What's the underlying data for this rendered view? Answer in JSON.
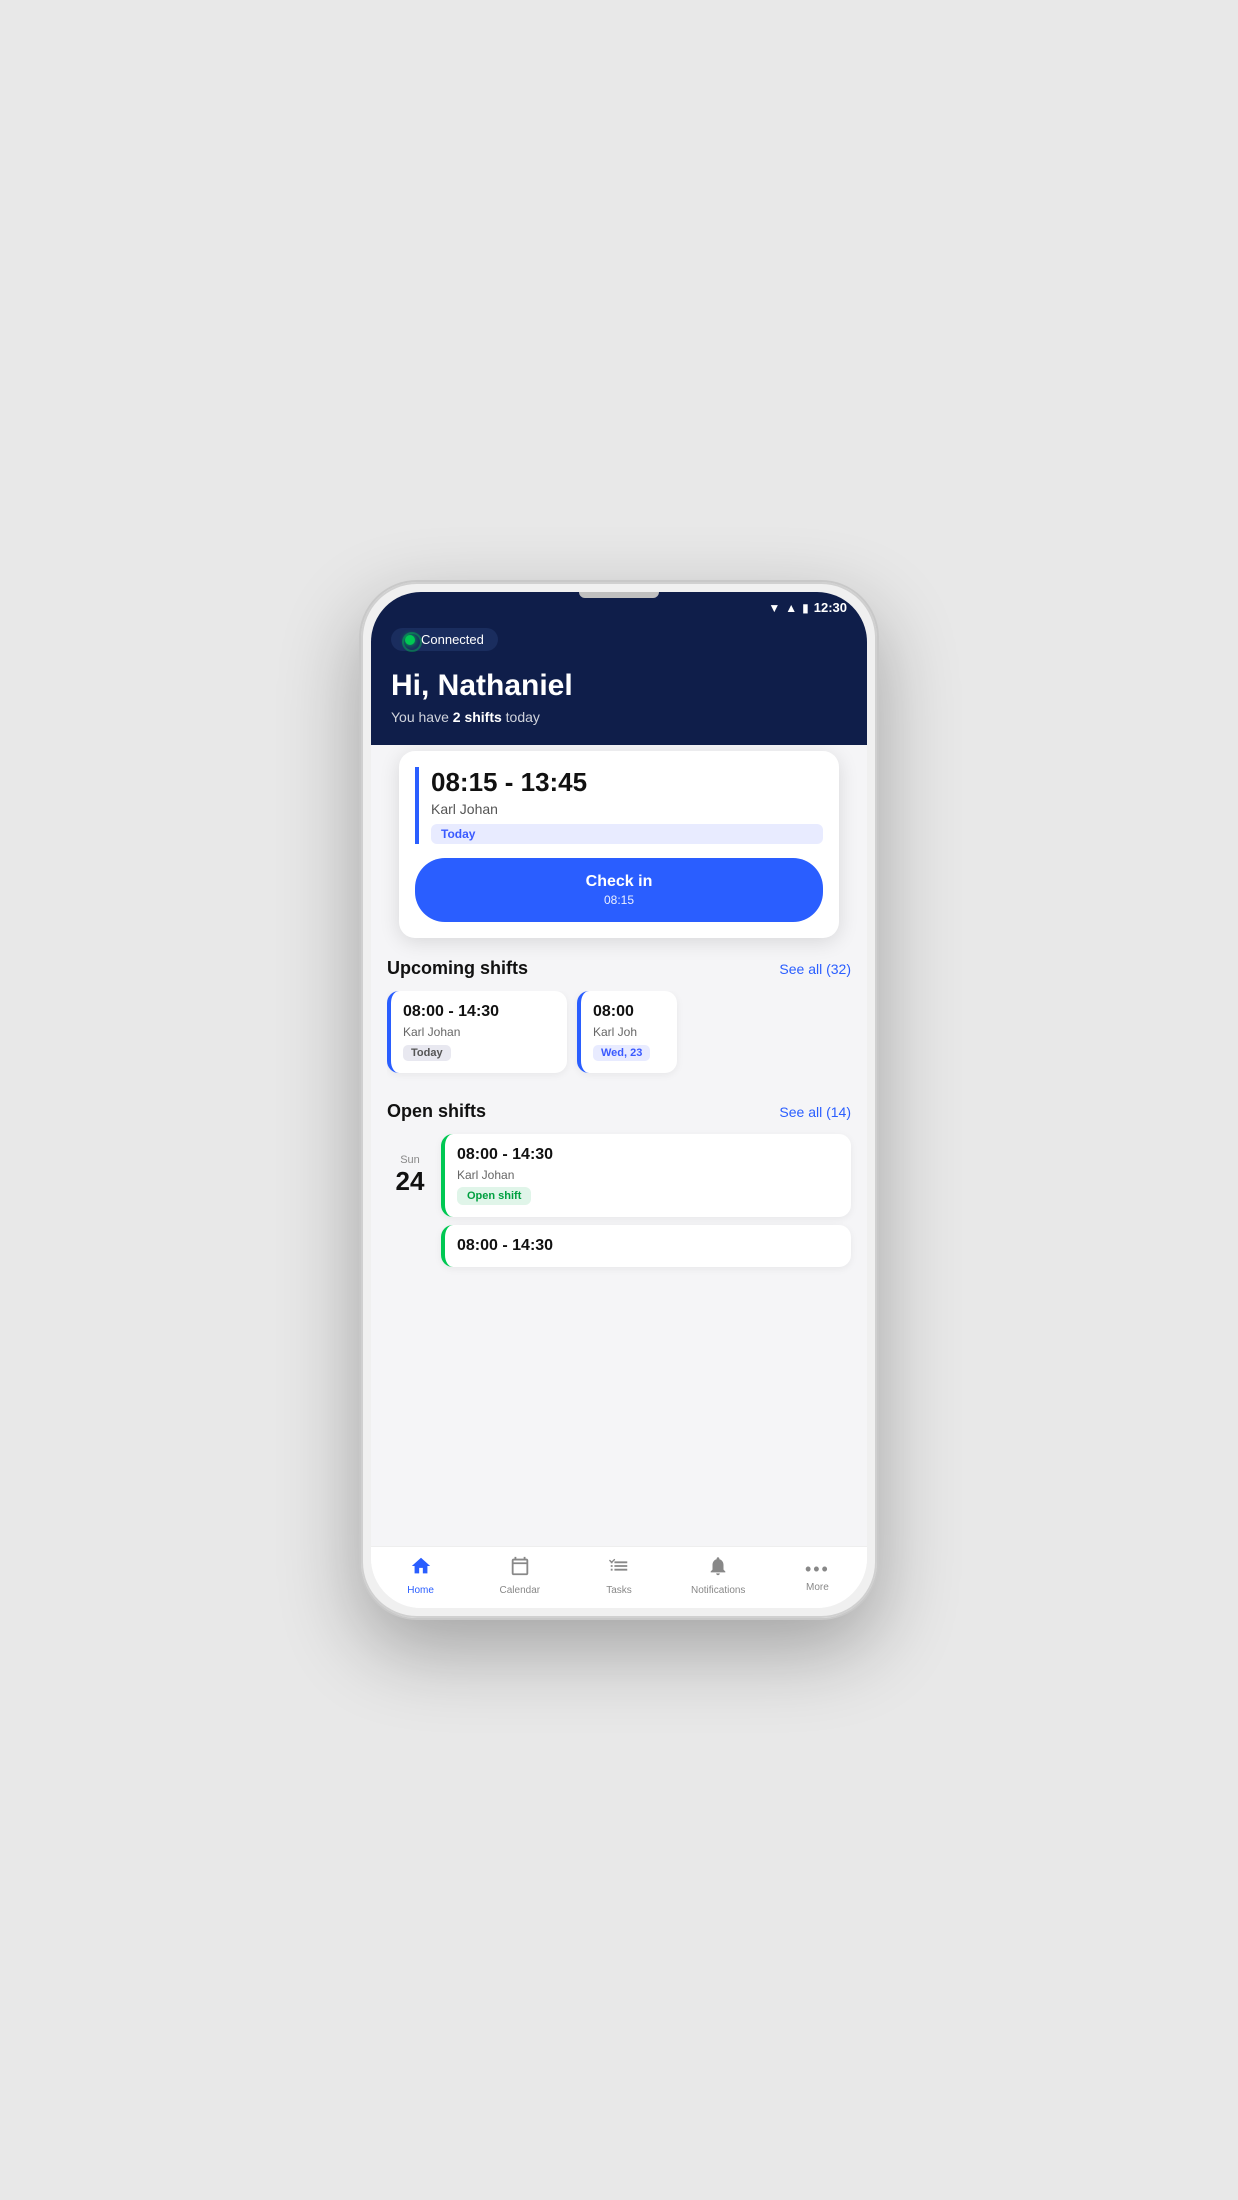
{
  "phone": {
    "status_bar": {
      "time": "12:30"
    },
    "header": {
      "connected_label": "Connected",
      "greeting": "Hi, Nathaniel",
      "subtitle_prefix": "You have ",
      "subtitle_shifts": "2 shifts",
      "subtitle_suffix": " today"
    },
    "current_shift": {
      "time_range": "08:15 - 13:45",
      "location": "Karl Johan",
      "badge": "Today",
      "checkin_label": "Check in",
      "checkin_time": "08:15"
    },
    "upcoming_shifts": {
      "title": "Upcoming shifts",
      "see_all": "See all (32)",
      "items": [
        {
          "time_range": "08:00 - 14:30",
          "location": "Karl Johan",
          "badge": "Today"
        },
        {
          "time_range": "08:00",
          "location": "Karl Joh",
          "badge": "Wed, 23"
        }
      ]
    },
    "open_shifts": {
      "title": "Open shifts",
      "see_all": "See all (14)",
      "items": [
        {
          "day_name": "Sun",
          "day_num": "24",
          "time_range": "08:00 - 14:30",
          "location": "Karl Johan",
          "badge": "Open shift"
        },
        {
          "time_range": "08:00 - 14:30",
          "location": "",
          "badge": ""
        }
      ]
    },
    "bottom_nav": {
      "items": [
        {
          "label": "Home",
          "icon": "🏠",
          "active": true
        },
        {
          "label": "Calendar",
          "icon": "📅",
          "active": false
        },
        {
          "label": "Tasks",
          "icon": "✅",
          "active": false
        },
        {
          "label": "Notifications",
          "icon": "🔔",
          "active": false
        },
        {
          "label": "More",
          "icon": "···",
          "active": false
        }
      ]
    }
  }
}
